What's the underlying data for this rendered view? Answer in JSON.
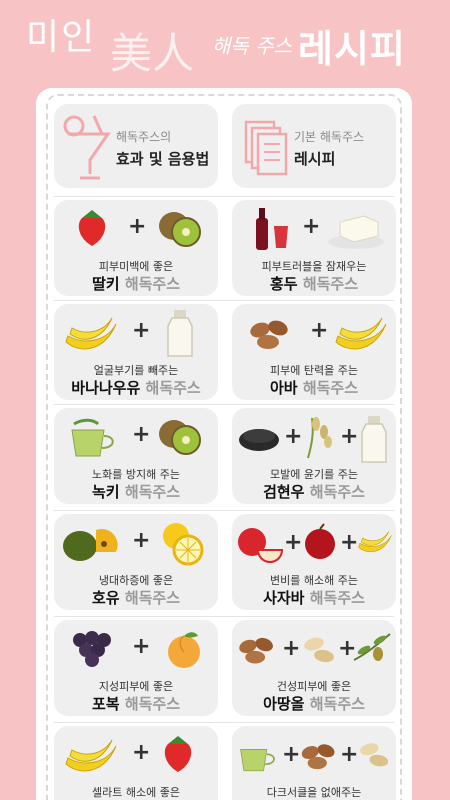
{
  "header": {
    "title_mi": "미인",
    "title_hanja": "美人",
    "title_script": "해독 주스",
    "title_recipe": "레시피"
  },
  "top_tiles": [
    {
      "small": "해독주스의",
      "big": "효과 및 음용법",
      "icon": "juice-glass-icon"
    },
    {
      "small": "기본 해독주스",
      "big": "레시피",
      "icon": "document-stack-icon"
    }
  ],
  "recipes": [
    {
      "sub": "피부미백에 좋은",
      "name": "딸키",
      "suffix": "해독주스",
      "ingredients": [
        "strawberry",
        "kiwi"
      ]
    },
    {
      "sub": "피부트러블을 잠재우는",
      "name": "홍두",
      "suffix": "해독주스",
      "ingredients": [
        "red-ginseng",
        "tofu"
      ]
    },
    {
      "sub": "얼굴부기를 빼주는",
      "name": "바나나우유",
      "suffix": "해독주스",
      "ingredients": [
        "banana",
        "milk"
      ]
    },
    {
      "sub": "피부에 탄력을 주는",
      "name": "아바",
      "suffix": "해독주스",
      "ingredients": [
        "almond",
        "banana"
      ]
    },
    {
      "sub": "노화를 방지해 주는",
      "name": "녹키",
      "suffix": "해독주스",
      "ingredients": [
        "green-tea",
        "kiwi"
      ]
    },
    {
      "sub": "모발에 윤기를 주는",
      "name": "검현우",
      "suffix": "해독주스",
      "ingredients": [
        "black-sesame",
        "brown-rice",
        "milk"
      ]
    },
    {
      "sub": "냉대하증에 좋은",
      "name": "호유",
      "suffix": "해독주스",
      "ingredients": [
        "pumpkin",
        "yuzu"
      ]
    },
    {
      "sub": "변비를 해소해 주는",
      "name": "사자바",
      "suffix": "해독주스",
      "ingredients": [
        "apple",
        "plum",
        "banana"
      ]
    },
    {
      "sub": "지성피부에 좋은",
      "name": "포복",
      "suffix": "해독주스",
      "ingredients": [
        "grape",
        "peach"
      ]
    },
    {
      "sub": "건성피부에 좋은",
      "name": "아땅올",
      "suffix": "해독주스",
      "ingredients": [
        "almond",
        "peanut",
        "olive"
      ]
    },
    {
      "sub": "셀라트 해소에 좋은",
      "name": "",
      "suffix": "",
      "ingredients": [
        "banana",
        "strawberry"
      ]
    },
    {
      "sub": "다크서클을 없애주는",
      "name": "",
      "suffix": "",
      "ingredients": [
        "green-tea",
        "almond",
        "peanut"
      ]
    }
  ],
  "colors": {
    "background": "#f7c3c4",
    "card": "#ffffff",
    "tile": "#efefef",
    "accent_pink": "#f3a7ab"
  }
}
